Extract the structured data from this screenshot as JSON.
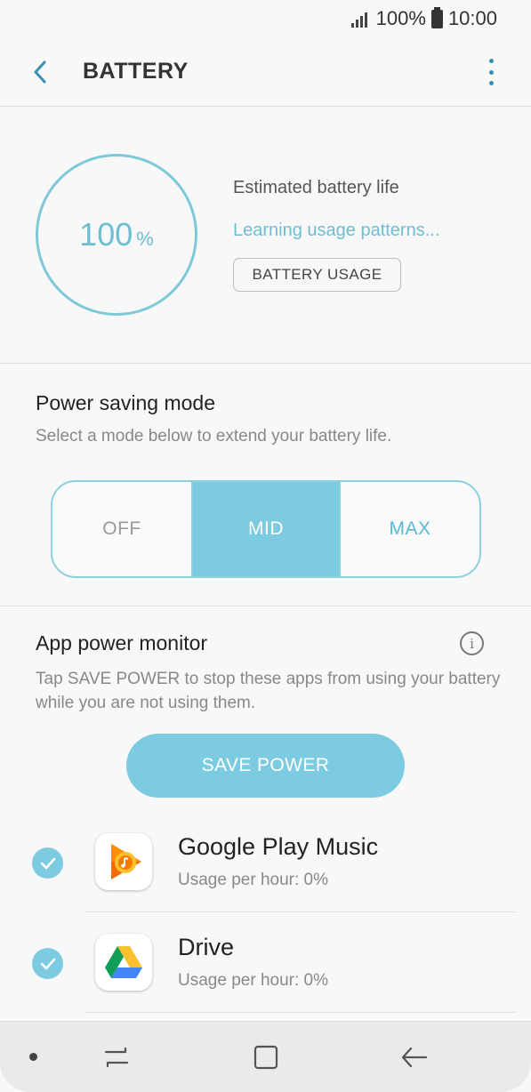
{
  "status_bar": {
    "battery_percent": "100%",
    "time": "10:00"
  },
  "header": {
    "title": "BATTERY"
  },
  "battery": {
    "percent_value": "100",
    "percent_sign": "%",
    "estimated_label": "Estimated battery life",
    "learning_text": "Learning usage patterns...",
    "usage_button": "BATTERY USAGE"
  },
  "power_saving": {
    "title": "Power saving mode",
    "subtitle": "Select a mode below to extend your battery life.",
    "options": [
      "OFF",
      "MID",
      "MAX"
    ],
    "selected": "MID"
  },
  "app_power_monitor": {
    "title": "App power monitor",
    "info_glyph": "i",
    "description": "Tap SAVE POWER to stop these apps from using your battery while you are not using them.",
    "save_button": "SAVE POWER",
    "apps": [
      {
        "name": "Google Play Music",
        "usage": "Usage per hour: 0%",
        "checked": true,
        "icon": "google-play-music-icon"
      },
      {
        "name": "Drive",
        "usage": "Usage per hour: 0%",
        "checked": true,
        "icon": "google-drive-icon"
      }
    ]
  },
  "colors": {
    "accent": "#7dcbe1",
    "accent_text": "#6dbed0",
    "header_icon": "#3b8fb0"
  }
}
